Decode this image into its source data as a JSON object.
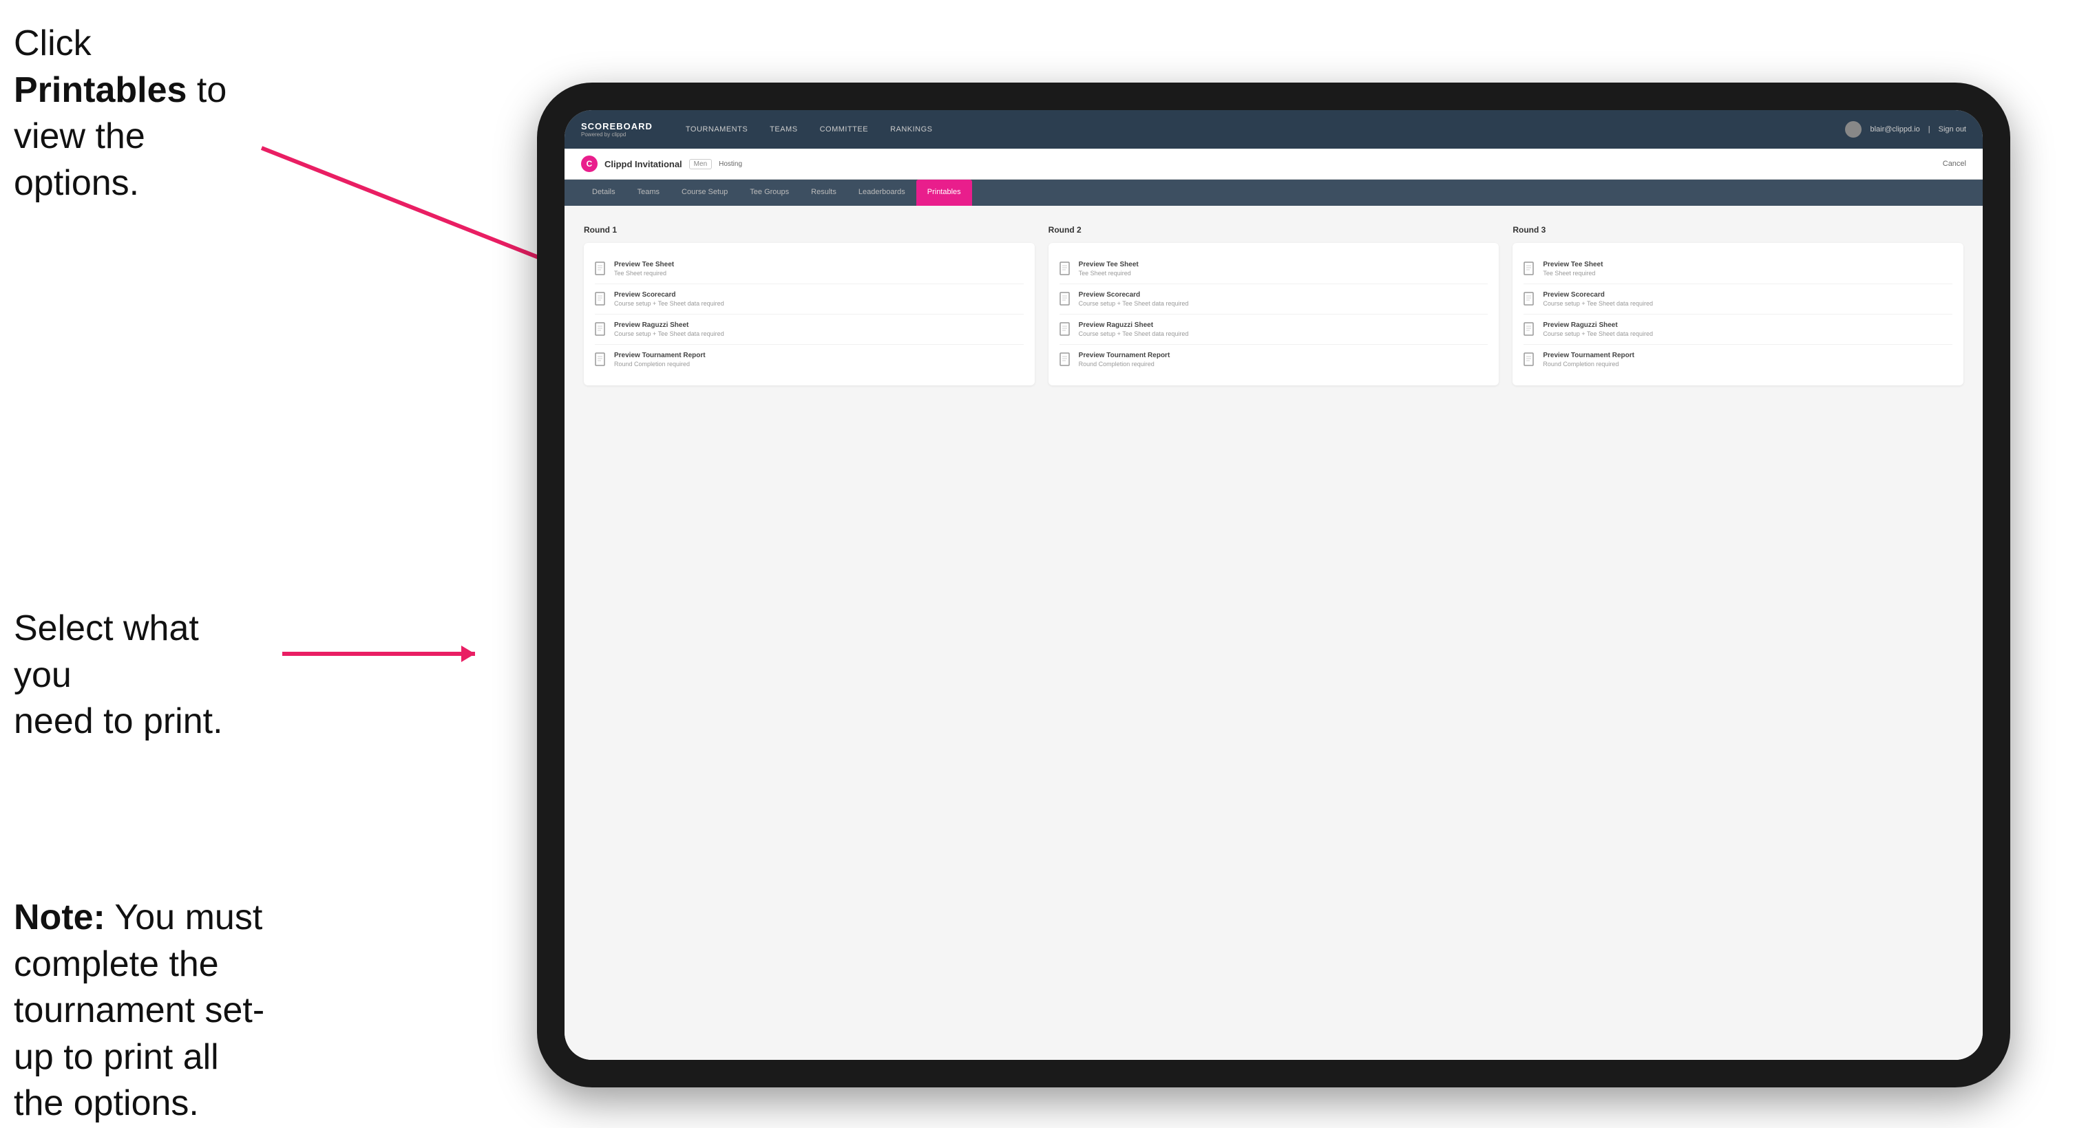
{
  "instructions": {
    "top": {
      "text_plain": "Click ",
      "text_bold": "Printables",
      "text_after": " to view the options."
    },
    "middle": {
      "line1": "Select what you",
      "line2": "need to print."
    },
    "bottom": {
      "bold": "Note:",
      "plain": " You must complete the tournament set-up to print all the options."
    }
  },
  "nav": {
    "logo_title": "SCOREBOARD",
    "logo_sub": "Powered by clippd",
    "links": [
      {
        "label": "TOURNAMENTS",
        "active": false
      },
      {
        "label": "TEAMS",
        "active": false
      },
      {
        "label": "COMMITTEE",
        "active": false
      },
      {
        "label": "RANKINGS",
        "active": false
      }
    ],
    "user_email": "blair@clippd.io",
    "sign_out": "Sign out"
  },
  "tournament": {
    "logo_letter": "C",
    "name": "Clippd Invitational",
    "badge": "Men",
    "hosting": "Hosting",
    "cancel": "Cancel"
  },
  "sub_tabs": [
    {
      "label": "Details"
    },
    {
      "label": "Teams"
    },
    {
      "label": "Course Setup"
    },
    {
      "label": "Tee Groups"
    },
    {
      "label": "Results"
    },
    {
      "label": "Leaderboards"
    },
    {
      "label": "Printables",
      "active": true
    }
  ],
  "rounds": [
    {
      "title": "Round 1",
      "items": [
        {
          "title": "Preview Tee Sheet",
          "sub": "Tee Sheet required"
        },
        {
          "title": "Preview Scorecard",
          "sub": "Course setup + Tee Sheet data required"
        },
        {
          "title": "Preview Raguzzi Sheet",
          "sub": "Course setup + Tee Sheet data required"
        },
        {
          "title": "Preview Tournament Report",
          "sub": "Round Completion required"
        }
      ]
    },
    {
      "title": "Round 2",
      "items": [
        {
          "title": "Preview Tee Sheet",
          "sub": "Tee Sheet required"
        },
        {
          "title": "Preview Scorecard",
          "sub": "Course setup + Tee Sheet data required"
        },
        {
          "title": "Preview Raguzzi Sheet",
          "sub": "Course setup + Tee Sheet data required"
        },
        {
          "title": "Preview Tournament Report",
          "sub": "Round Completion required"
        }
      ]
    },
    {
      "title": "Round 3",
      "items": [
        {
          "title": "Preview Tee Sheet",
          "sub": "Tee Sheet required"
        },
        {
          "title": "Preview Scorecard",
          "sub": "Course setup + Tee Sheet data required"
        },
        {
          "title": "Preview Raguzzi Sheet",
          "sub": "Course setup + Tee Sheet data required"
        },
        {
          "title": "Preview Tournament Report",
          "sub": "Round Completion required"
        }
      ]
    }
  ],
  "colors": {
    "accent": "#e91e8c",
    "nav_bg": "#2c3e50",
    "sub_nav_bg": "#3d4f61"
  }
}
